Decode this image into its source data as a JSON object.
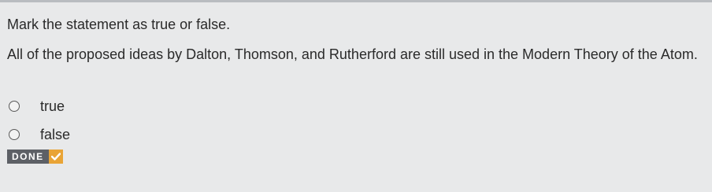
{
  "question": {
    "instruction": "Mark the statement as true or false.",
    "statement": "All of the proposed ideas by Dalton, Thomson, and Rutherford are still used in the Modern Theory of the Atom."
  },
  "options": [
    {
      "label": "true",
      "selected": false
    },
    {
      "label": "false",
      "selected": false
    }
  ],
  "done_button": {
    "label": "DONE",
    "icon": "checkmark-icon",
    "accent_color": "#e9a436"
  }
}
